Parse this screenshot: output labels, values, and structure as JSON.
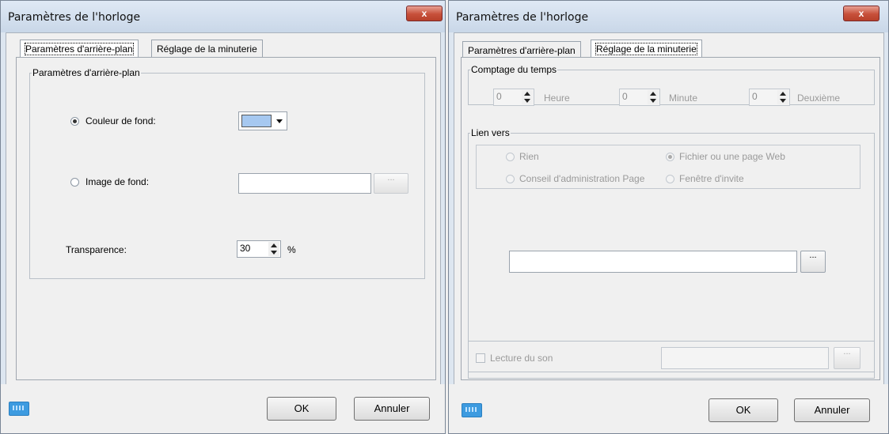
{
  "left_dialog": {
    "title": "Paramètres de l'horloge",
    "close_label": "x",
    "tabs": [
      {
        "label": "Paramètres d'arrière-plan",
        "active": true
      },
      {
        "label": "Réglage de la minuterie",
        "active": false
      }
    ],
    "group_title": "Paramètres d'arrière-plan",
    "background_color": {
      "label": "Couleur de fond:",
      "selected": true,
      "value": "#a6c8f0"
    },
    "background_image": {
      "label": "Image de fond:",
      "selected": false,
      "value": "",
      "browse_label": "..."
    },
    "transparency": {
      "label": "Transparence:",
      "value": "30",
      "unit": "%"
    },
    "ok_label": "OK",
    "cancel_label": "Annuler",
    "keyboard_icon": "keyboard-icon"
  },
  "right_dialog": {
    "title": "Paramètres de l'horloge",
    "close_label": "x",
    "tabs": [
      {
        "label": "Paramètres d'arrière-plan",
        "active": false
      },
      {
        "label": "Réglage de la minuterie",
        "active": true
      }
    ],
    "time_count": {
      "title": "Comptage du temps",
      "hour": {
        "value": "0",
        "label": "Heure"
      },
      "minute": {
        "value": "0",
        "label": "Minute"
      },
      "second": {
        "value": "0",
        "label": "Deuxième"
      }
    },
    "link": {
      "title": "Lien vers",
      "options": [
        {
          "label": "Rien",
          "selected": false
        },
        {
          "label": "Fichier ou une page Web",
          "selected": true
        },
        {
          "label": "Conseil d'administration Page",
          "selected": false
        },
        {
          "label": "Fenêtre d'invite",
          "selected": false
        }
      ],
      "path_value": "",
      "browse_label": "..."
    },
    "sound": {
      "label": "Lecture du son",
      "checked": false,
      "value": "",
      "browse_label": "..."
    },
    "ok_label": "OK",
    "cancel_label": "Annuler",
    "keyboard_icon": "keyboard-icon"
  },
  "colors": {
    "titlebar": "#c9d7e8",
    "close_button": "#c7503a",
    "color_swatch": "#a6c8f0"
  }
}
